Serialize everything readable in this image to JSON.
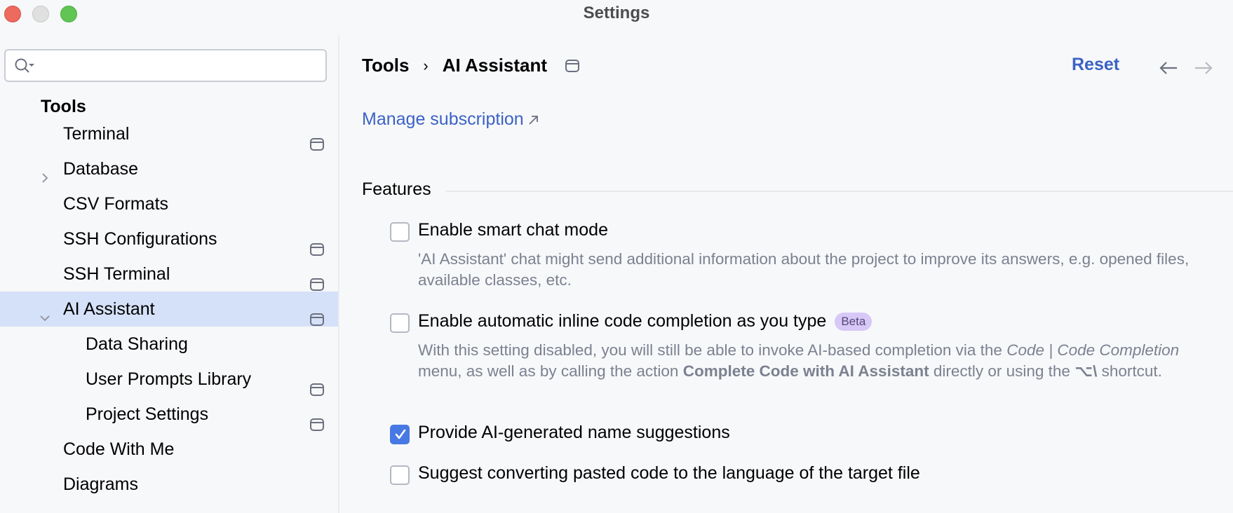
{
  "window": {
    "title": "Settings",
    "controls": [
      "close",
      "minimize",
      "maximize"
    ]
  },
  "sidebar": {
    "search": {
      "value": "",
      "placeholder": "",
      "icon": "search-icon"
    },
    "section_title": "Tools",
    "items": [
      {
        "label": "Terminal",
        "level": 1,
        "expandable": false,
        "expanded": false,
        "project_icon": true,
        "selected": false
      },
      {
        "label": "Database",
        "level": 1,
        "expandable": true,
        "expanded": false,
        "project_icon": false,
        "selected": false
      },
      {
        "label": "CSV Formats",
        "level": 1,
        "expandable": false,
        "expanded": false,
        "project_icon": false,
        "selected": false
      },
      {
        "label": "SSH Configurations",
        "level": 1,
        "expandable": false,
        "expanded": false,
        "project_icon": true,
        "selected": false
      },
      {
        "label": "SSH Terminal",
        "level": 1,
        "expandable": false,
        "expanded": false,
        "project_icon": true,
        "selected": false
      },
      {
        "label": "AI Assistant",
        "level": 1,
        "expandable": true,
        "expanded": true,
        "project_icon": true,
        "selected": true
      },
      {
        "label": "Data Sharing",
        "level": 2,
        "expandable": false,
        "expanded": false,
        "project_icon": false,
        "selected": false
      },
      {
        "label": "User Prompts Library",
        "level": 2,
        "expandable": false,
        "expanded": false,
        "project_icon": true,
        "selected": false
      },
      {
        "label": "Project Settings",
        "level": 2,
        "expandable": false,
        "expanded": false,
        "project_icon": true,
        "selected": false
      },
      {
        "label": "Code With Me",
        "level": 1,
        "expandable": false,
        "expanded": false,
        "project_icon": false,
        "selected": false
      },
      {
        "label": "Diagrams",
        "level": 1,
        "expandable": false,
        "expanded": false,
        "project_icon": false,
        "selected": false
      }
    ]
  },
  "header": {
    "breadcrumb": [
      "Tools",
      "AI Assistant"
    ],
    "breadcrumb_separator": "›",
    "reset_label": "Reset",
    "back_icon": "arrow-left-icon",
    "forward_icon": "arrow-right-icon",
    "forward_enabled": false
  },
  "manage_link": {
    "label": "Manage subscription",
    "icon": "external-link-arrow-icon"
  },
  "features": {
    "title": "Features",
    "options": [
      {
        "label": "Enable smart chat mode",
        "checked": false,
        "badge": null,
        "description": "'AI Assistant' chat might send additional information about the project to improve its answers, e.g. opened files, available classes, etc."
      },
      {
        "label": "Enable automatic inline code completion as you type",
        "checked": false,
        "badge": "Beta",
        "description_parts": {
          "p1": "With this setting disabled, you will still be able to invoke AI-based completion via the ",
          "menu_path": "Code | Code Completion",
          "p2": " menu, as well as by calling the action ",
          "action": "Complete Code with AI Assistant",
          "p3": " directly or using the ",
          "shortcut": "⌥\\",
          "p4": " shortcut."
        }
      },
      {
        "label": "Provide AI-generated name suggestions",
        "checked": true,
        "badge": null
      },
      {
        "label": "Suggest converting pasted code to the language of the target file",
        "checked": false,
        "badge": null
      }
    ]
  },
  "colors": {
    "background": "#f7f8fa",
    "selection": "#d5e1f8",
    "link": "#3b62c4",
    "checkbox_checked": "#4779e4",
    "badge_bg": "#d7c8f7",
    "secondary_text": "#7c8190"
  }
}
